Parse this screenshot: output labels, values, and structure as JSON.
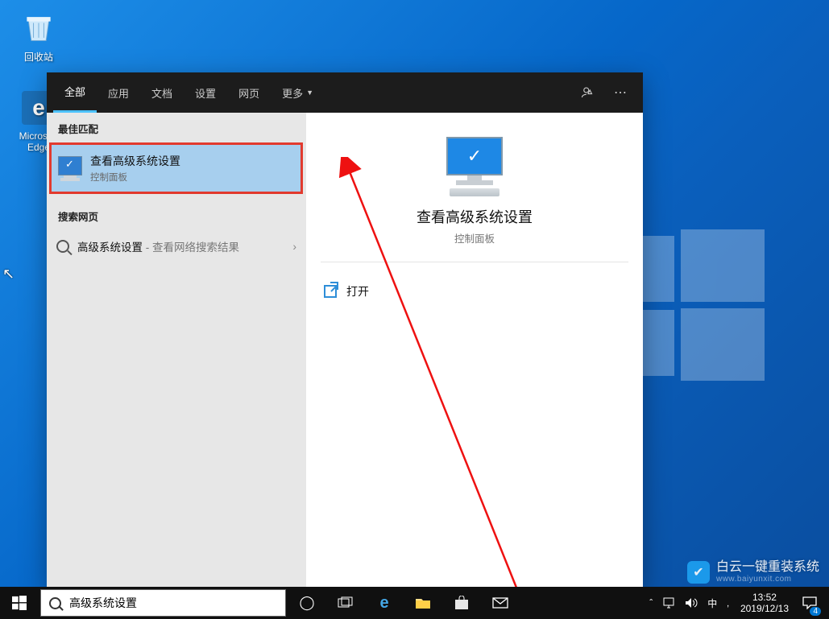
{
  "desktop": {
    "icons": {
      "recycle": "回收站",
      "edge": "Microsoft Edge"
    }
  },
  "search": {
    "tabs": {
      "all": "全部",
      "apps": "应用",
      "docs": "文档",
      "settings": "设置",
      "web": "网页",
      "more": "更多"
    },
    "sections": {
      "best": "最佳匹配",
      "web": "搜索网页"
    },
    "best_result": {
      "title": "查看高级系统设置",
      "subtitle": "控制面板"
    },
    "web_result": {
      "term": "高级系统设置",
      "suffix": " - 查看网络搜索结果"
    },
    "detail": {
      "title": "查看高级系统设置",
      "subtitle": "控制面板",
      "open": "打开"
    }
  },
  "taskbar": {
    "search_value": "高级系统设置",
    "tray": {
      "ime_lang": "中",
      "ime_mode": "‚"
    },
    "time": "13:52",
    "date": "2019/12/13",
    "notif_count": "4"
  },
  "watermark": {
    "title": "白云一键重装系统",
    "url": "www.baiyunxit.com"
  }
}
